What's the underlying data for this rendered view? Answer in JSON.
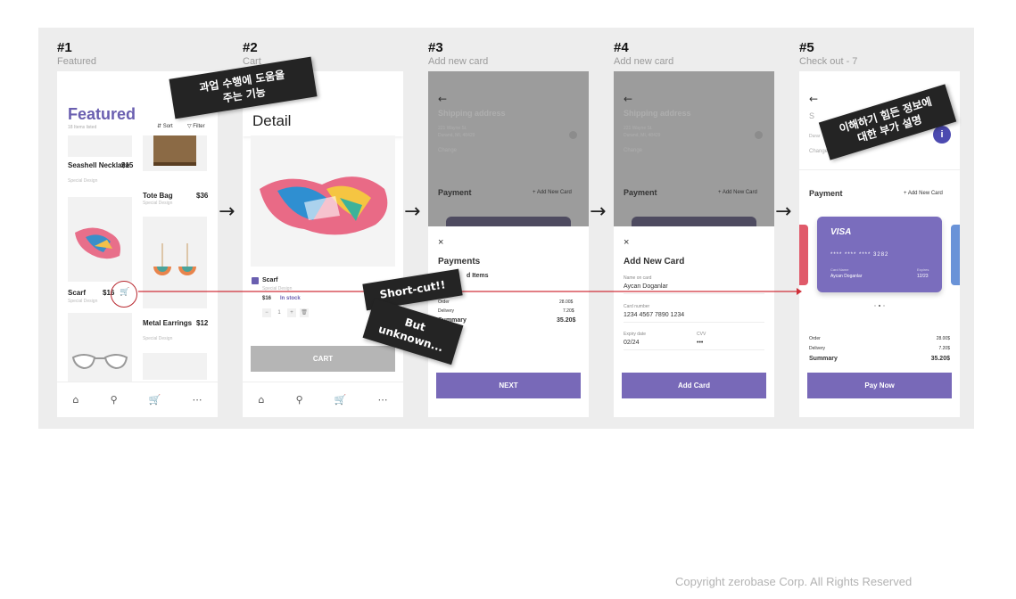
{
  "screens": [
    {
      "num": "#1",
      "sub": "Featured"
    },
    {
      "num": "#2",
      "sub": "Cart"
    },
    {
      "num": "#3",
      "sub": "Add new card"
    },
    {
      "num": "#4",
      "sub": "Add new card"
    },
    {
      "num": "#5",
      "sub": "Check out - 7"
    }
  ],
  "arrow_glyph": "→",
  "s1": {
    "title": "Featured",
    "count": "18 Items listed",
    "sort": "Sort",
    "filter": "Filter",
    "products": [
      {
        "name": "Seashell Necklace",
        "price": "$15",
        "sub": "Special Design"
      },
      {
        "name": "Tote Bag",
        "price": "$36",
        "sub": "Special Design"
      },
      {
        "name": "Scarf",
        "price": "$16",
        "sub": "Special Design"
      },
      {
        "name": "Metal Earrings",
        "price": "$12",
        "sub": "Special Design"
      }
    ]
  },
  "s2": {
    "title": "Detail",
    "item_name": "Scarf",
    "item_sub": "Special Design",
    "price": "$16",
    "stock": "In stock",
    "qty_minus": "−",
    "qty": "1",
    "qty_plus": "+",
    "cart_label": "CART"
  },
  "s3": {
    "shipping_title": "Shipping address",
    "address1": "221 Wayne St.",
    "address2": "Durand, MI, 48429",
    "change": "Change",
    "payment": "Payment",
    "add_new_card": "+ Add New Card",
    "close": "×",
    "payments_title": "Payments",
    "saved_items": "d Items",
    "order_label": "Order",
    "order_val": "28.00$",
    "delivery_label": "Delivery",
    "delivery_val": "7.20$",
    "summary_label": "Summary",
    "summary_val": "35.20$",
    "next_label": "NEXT"
  },
  "s4": {
    "shipping_title": "Shipping address",
    "address1": "221 Wayne St.",
    "address2": "Durand, MI, 48429",
    "change": "Change",
    "payment": "Payment",
    "add_new_card": "+ Add New Card",
    "close": "×",
    "title": "Add New Card",
    "name_label": "Name on card",
    "name_val": "Aycan Doganlar",
    "number_label": "Card number",
    "number_val": "1234  4567  7890  1234",
    "expiry_label": "Expiry date",
    "expiry_val": "02/24",
    "cvv_label": "CVV",
    "cvv_val": "•••",
    "button": "Add Card"
  },
  "s5": {
    "back": "←",
    "shipping_initial": "S",
    "address_initial": "Durar",
    "change": "Change",
    "info_badge": "i",
    "payment": "Payment",
    "add_new_card": "+ Add New Card",
    "card_brand": "VISA",
    "card_number": "****  ****  ****  3282",
    "card_name_label": "Card Name",
    "card_name": "Aycan Doganlar",
    "expires_label": "Expires",
    "expires": "12/23",
    "order_label": "Order",
    "order_val": "28.00$",
    "delivery_label": "Delivery",
    "delivery_val": "7.20$",
    "summary_label": "Summary",
    "summary_val": "35.20$",
    "button": "Pay Now"
  },
  "notes": {
    "help": "과업 수행에 도움을\n주는 기능",
    "info": "이해하기 힘든 정보에\n대한 부가 설명",
    "shortcut": "Short-cut!!",
    "unknown": "But\nunknown..."
  },
  "copyright": "Copyright zerobase Corp. All Rights Reserved",
  "colors": {
    "accent": "#7869b8",
    "highlight_line": "#d0303a",
    "note_bg": "#242424"
  }
}
